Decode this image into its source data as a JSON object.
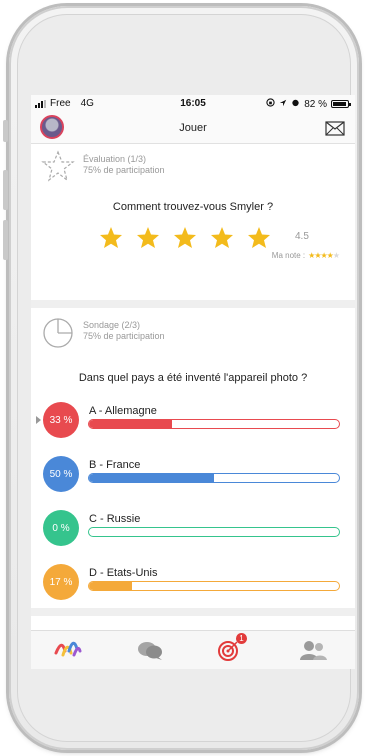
{
  "status_bar": {
    "carrier": "Free",
    "network": "4G",
    "time": "16:05",
    "battery": "82 %"
  },
  "header": {
    "title": "Jouer"
  },
  "evaluation": {
    "title": "Évaluation (1/3)",
    "participation": "75% de participation",
    "question": "Comment trouvez-vous Smyler ?",
    "average": "4.5",
    "my_note_label": "Ma note :",
    "my_note_stars": 4,
    "max_stars": 5
  },
  "poll": {
    "title": "Sondage (2/3)",
    "participation": "75% de participation",
    "question": "Dans quel pays a été inventé l'appareil photo ?",
    "options": [
      {
        "percent_label": "33 %",
        "label": "A - Allemagne",
        "value": 0.33,
        "color": "#e84a4f"
      },
      {
        "percent_label": "50 %",
        "label": "B - France",
        "value": 0.5,
        "color": "#4a88d8"
      },
      {
        "percent_label": "0 %",
        "label": "C - Russie",
        "value": 0.0,
        "color": "#35c48d"
      },
      {
        "percent_label": "17 %",
        "label": "D - Etats-Unis",
        "value": 0.17,
        "color": "#f4a93a"
      }
    ]
  },
  "colors": {
    "star": "#f3bb1c",
    "accent_red": "#e23b3b"
  },
  "tabbar": {
    "items": [
      {
        "icon": "smyler-logo-icon"
      },
      {
        "icon": "chat-bubbles-icon"
      },
      {
        "icon": "target-icon",
        "badge": "1"
      },
      {
        "icon": "users-icon"
      }
    ]
  }
}
